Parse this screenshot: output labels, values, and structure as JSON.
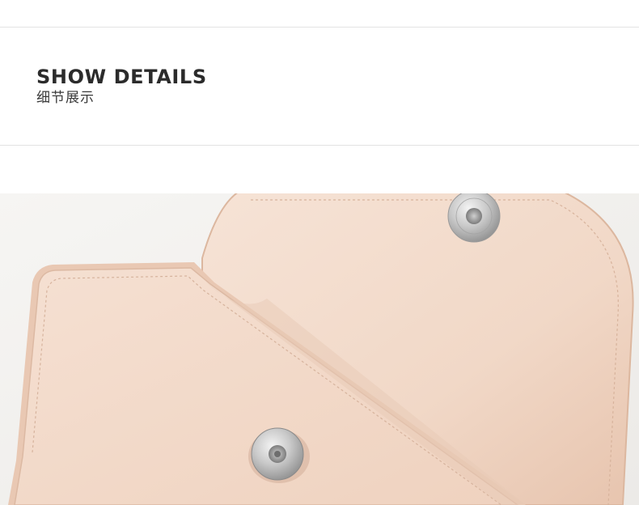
{
  "section": {
    "title": "SHOW DETAILS",
    "subtitle": "细节展示"
  },
  "photo": {
    "subject": "wallet-detail-photo",
    "colors": {
      "background": "#f2f1ef",
      "leather": "#f1d9c8",
      "leather_shadow": "#e6c6b1",
      "edge": "#d9b39b",
      "metal": "#c8c8c8"
    }
  }
}
